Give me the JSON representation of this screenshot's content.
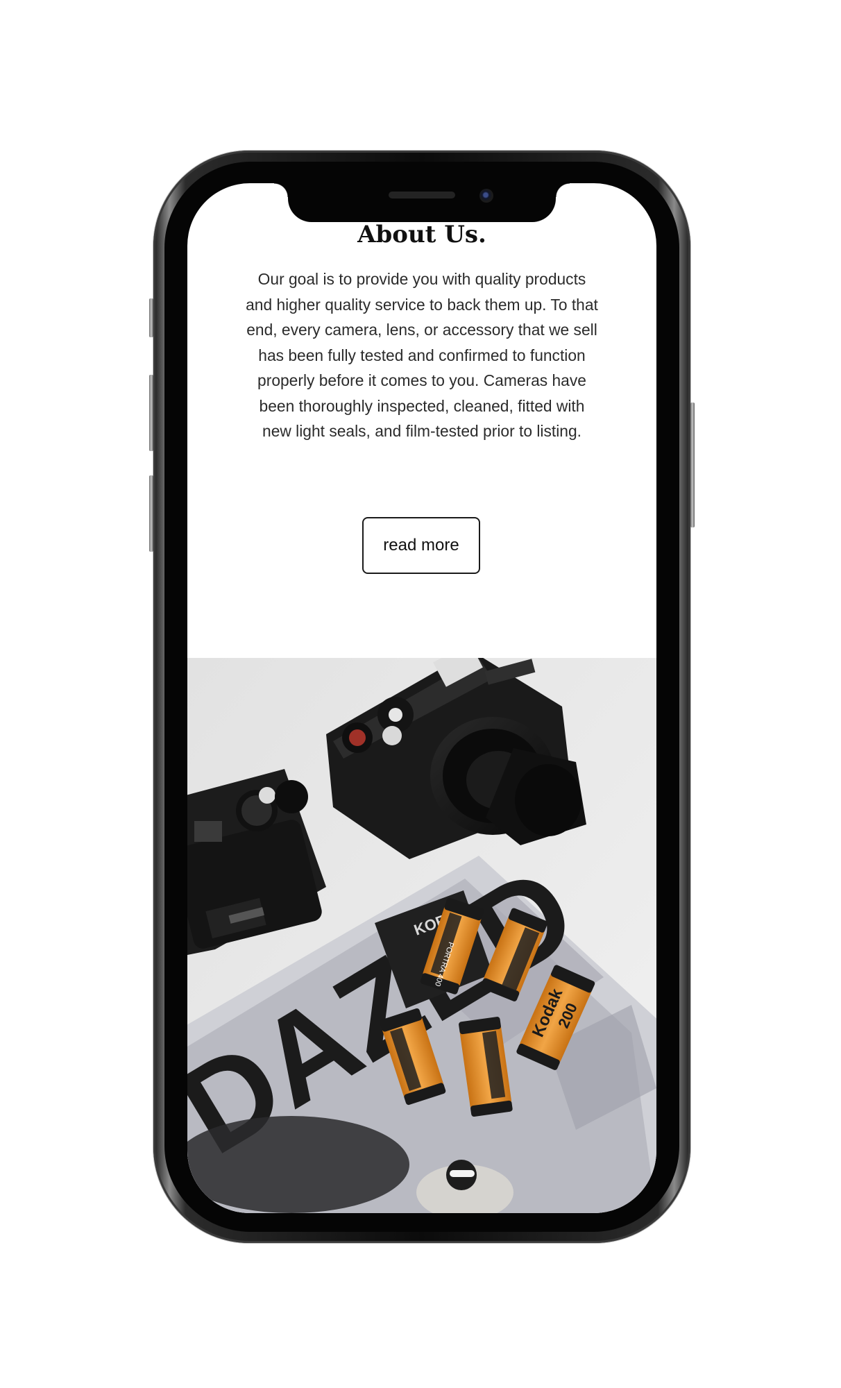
{
  "about": {
    "title": "About Us.",
    "body": "Our goal is to provide you with quality products and higher quality service to back them up. To that end, every camera, lens, or accessory that we sell has been fully tested and confirmed to function properly before it comes to you. Cameras have been thoroughly inspected, cleaned, fitted with new light seals, and film-tested prior to listing.",
    "button_label": "read more"
  },
  "photo": {
    "magazine_masthead": "DAZED",
    "magazine_issue": "KOREA",
    "film_brand": "Kodak",
    "film_speed": "200",
    "film_name": "PORTRA 400"
  },
  "colors": {
    "page_background": "#ffffff",
    "text": "#2b2b2b",
    "heading": "#111111",
    "button_border": "#1a1a1a",
    "film_orange": "#e8932a"
  }
}
